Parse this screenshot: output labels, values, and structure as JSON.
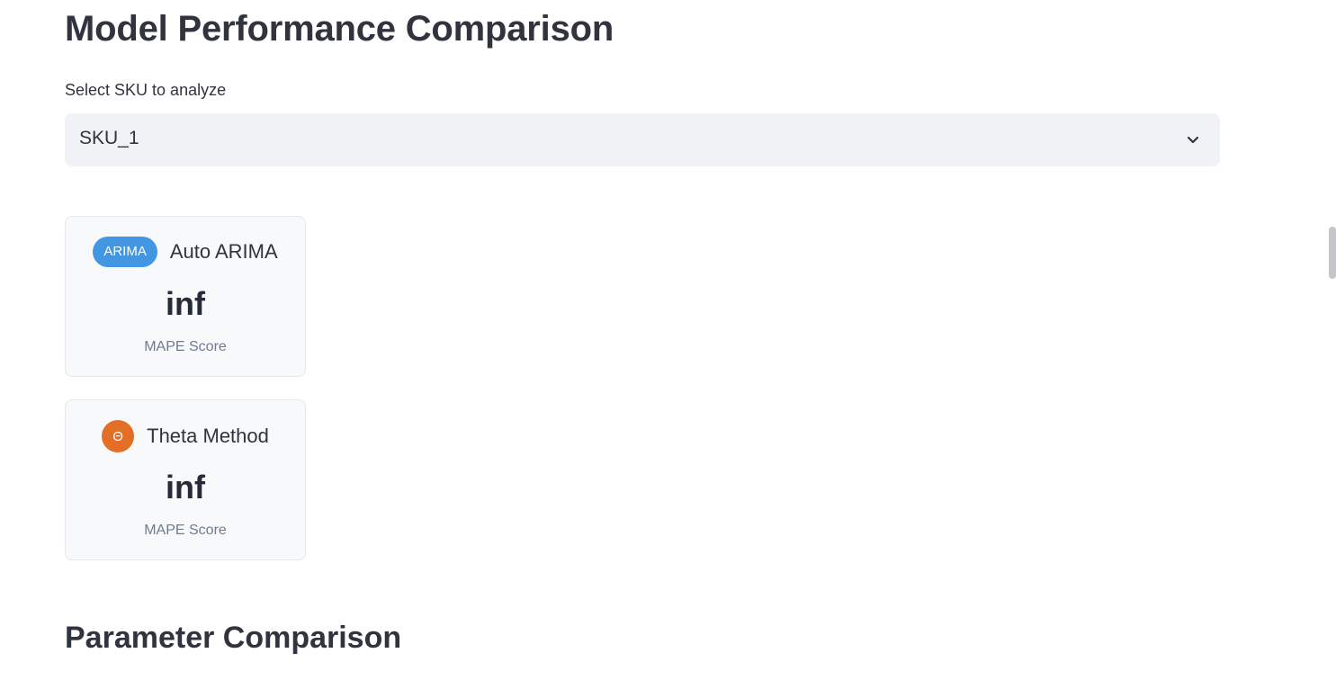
{
  "page": {
    "title": "Model Performance Comparison",
    "section_title": "Parameter Comparison"
  },
  "sku_select": {
    "label": "Select SKU to analyze",
    "value": "SKU_1"
  },
  "cards": [
    {
      "badge": "ARIMA",
      "badge_style": "pill",
      "badge_color": "#4396e2",
      "name": "Auto ARIMA",
      "value": "inf",
      "metric_label": "MAPE Score"
    },
    {
      "badge": "Θ",
      "badge_style": "circle",
      "badge_color": "#e36e25",
      "name": "Theta Method",
      "value": "inf",
      "metric_label": "MAPE Score"
    }
  ],
  "icons": {
    "dropdown": "chevron-down-icon"
  }
}
